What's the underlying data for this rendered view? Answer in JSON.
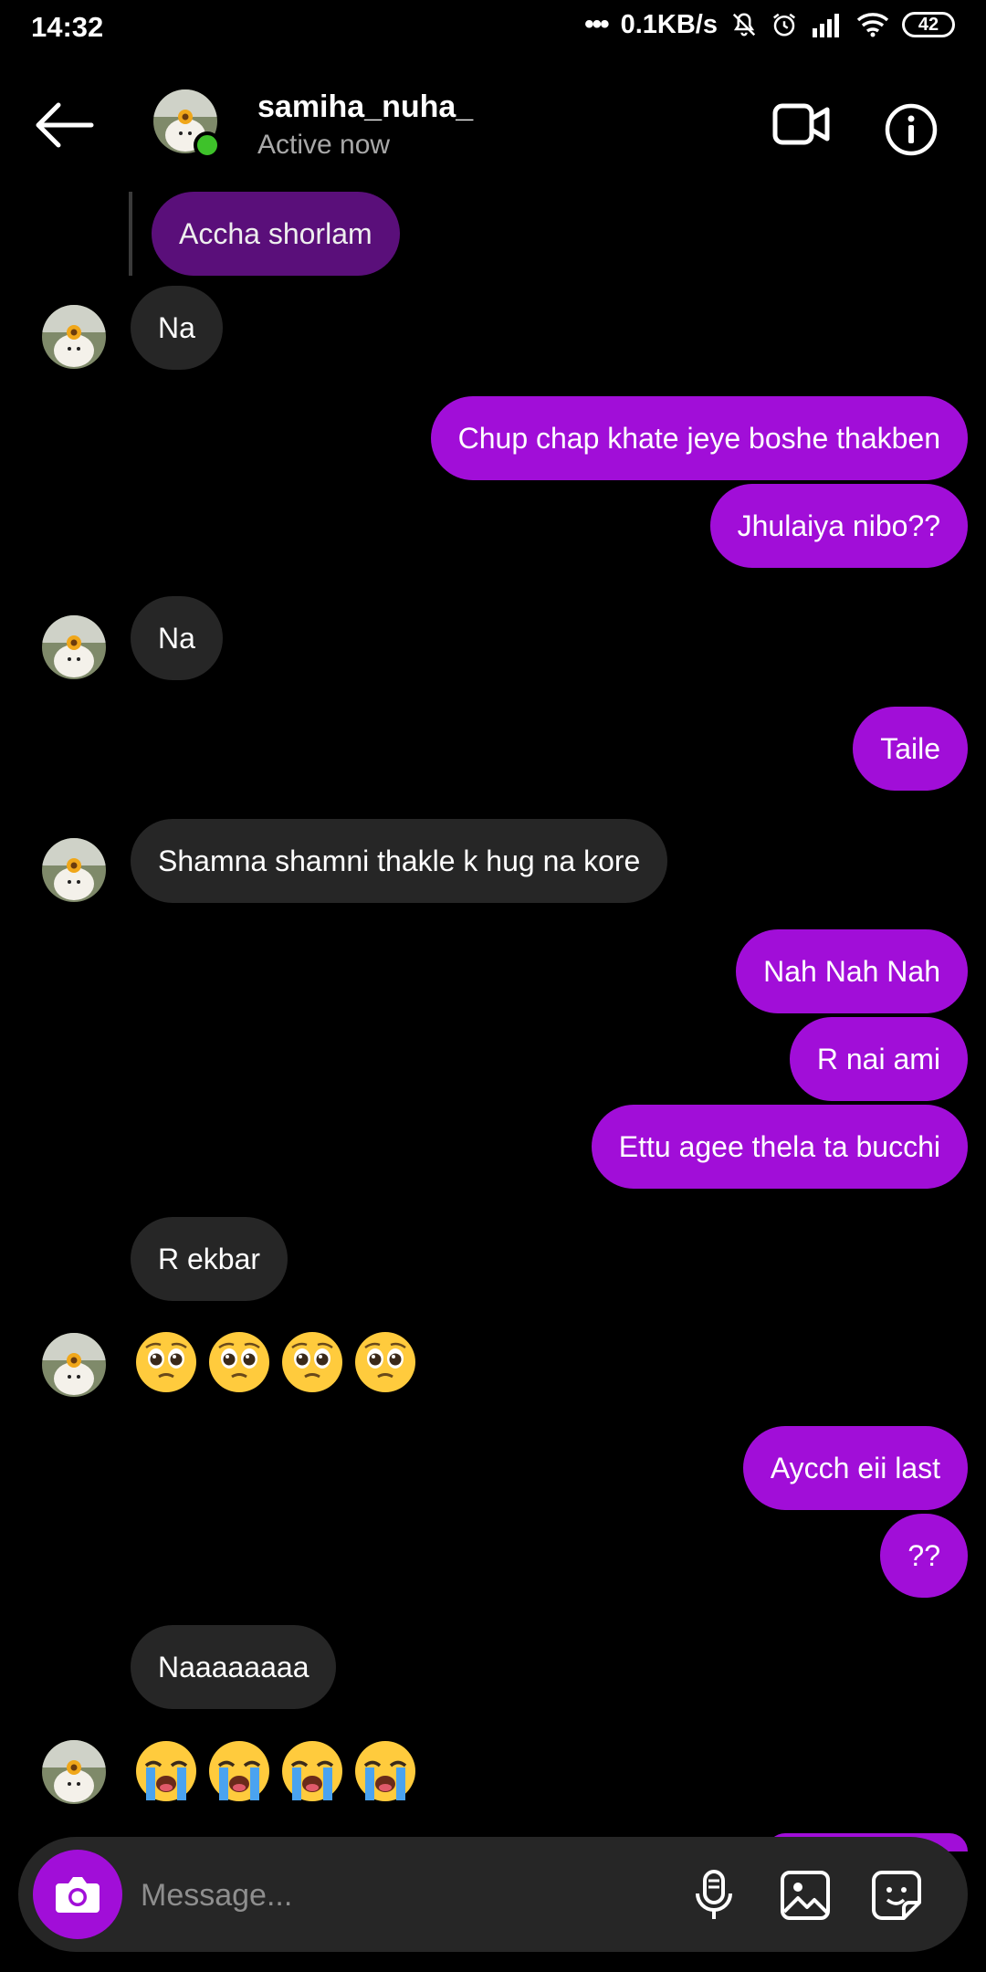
{
  "status_bar": {
    "time": "14:32",
    "network_speed": "0.1KB/s",
    "battery": "42"
  },
  "header": {
    "username": "samiha_nuha_",
    "status": "Active now"
  },
  "messages": {
    "reply_preview": "Accha shorlam",
    "m1": "Na",
    "m2": "Chup chap khate jeye boshe thakben",
    "m3": "Jhulaiya nibo??",
    "m4": "Na",
    "m5": "Taile",
    "m6": "Shamna shamni thakle k hug na kore",
    "m7": "Nah Nah Nah",
    "m8": "R nai ami",
    "m9": "Ettu agee thela ta bucchi",
    "m10": "R ekbar",
    "m11_emojis": [
      "pleading-face",
      "pleading-face",
      "pleading-face",
      "pleading-face"
    ],
    "m12": "Aycch eii last",
    "m13": "??",
    "m14": "Naaaaaaaa",
    "m15_emojis": [
      "loudly-crying-face",
      "loudly-crying-face",
      "loudly-crying-face",
      "loudly-crying-face"
    ]
  },
  "composer": {
    "placeholder": "Message..."
  },
  "colors": {
    "outgoing": "#a10ed8",
    "incoming": "#262626",
    "online": "#3ec22a",
    "background": "#000000"
  }
}
